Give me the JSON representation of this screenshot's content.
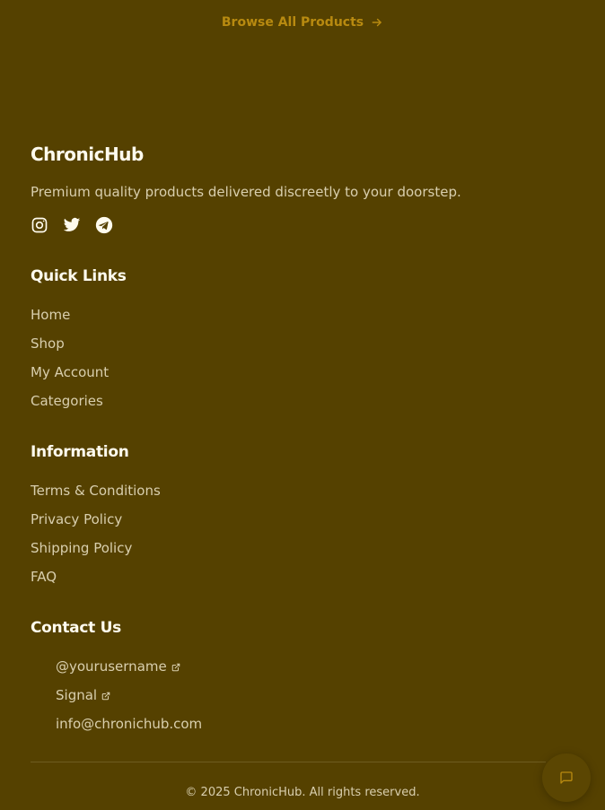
{
  "browse": {
    "label": "Browse All Products",
    "icon": "arrow-right-icon"
  },
  "brand": {
    "title": "ChronicHub",
    "tagline": "Premium quality products delivered discreetly to your doorstep.",
    "socials": [
      {
        "icon": "instagram-icon"
      },
      {
        "icon": "twitter-icon"
      },
      {
        "icon": "telegram-icon"
      }
    ]
  },
  "quick_links": {
    "title": "Quick Links",
    "items": [
      {
        "label": "Home"
      },
      {
        "label": "Shop"
      },
      {
        "label": "My Account"
      },
      {
        "label": "Categories"
      }
    ]
  },
  "information": {
    "title": "Information",
    "items": [
      {
        "label": "Terms & Conditions"
      },
      {
        "label": "Privacy Policy"
      },
      {
        "label": "Shipping Policy"
      },
      {
        "label": "FAQ"
      }
    ]
  },
  "contact": {
    "title": "Contact Us",
    "items": [
      {
        "label": "@yourusername",
        "icon": "external-link-icon"
      },
      {
        "label": "Signal",
        "icon": "external-link-icon"
      },
      {
        "label": "info@chronichub.com"
      }
    ]
  },
  "copyright": "© 2025 ChronicHub. All rights reserved.",
  "chat": {
    "icon": "chat-icon"
  },
  "colors": {
    "background": "#554100",
    "accent": "#b88a10",
    "text_muted": "#d9cfae",
    "heading": "#fffbee"
  }
}
